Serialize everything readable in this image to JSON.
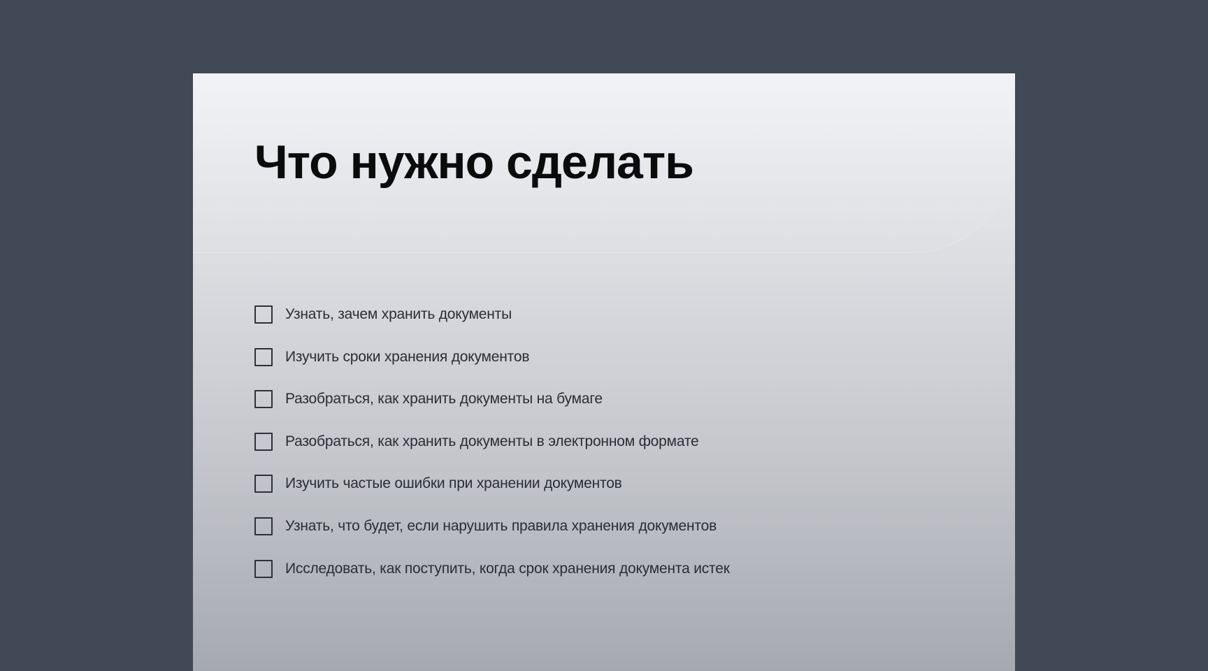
{
  "page": {
    "title": "Что нужно сделать"
  },
  "checklist": {
    "items": [
      {
        "label": "Узнать, зачем хранить документы",
        "checked": false
      },
      {
        "label": "Изучить сроки хранения документов",
        "checked": false
      },
      {
        "label": "Разобраться, как хранить документы на бумаге",
        "checked": false
      },
      {
        "label": "Разобраться, как хранить документы в электронном формате",
        "checked": false
      },
      {
        "label": "Изучить частые ошибки при хранении документов",
        "checked": false
      },
      {
        "label": "Узнать, что будет, если нарушить правила хранения документов",
        "checked": false
      },
      {
        "label": "Исследовать, как поступить, когда срок хранения документа истек",
        "checked": false
      }
    ]
  },
  "colors": {
    "background": "#414856",
    "title": "#0b0b0c",
    "text": "#2a2d33",
    "checkbox_border": "#2e3138"
  }
}
